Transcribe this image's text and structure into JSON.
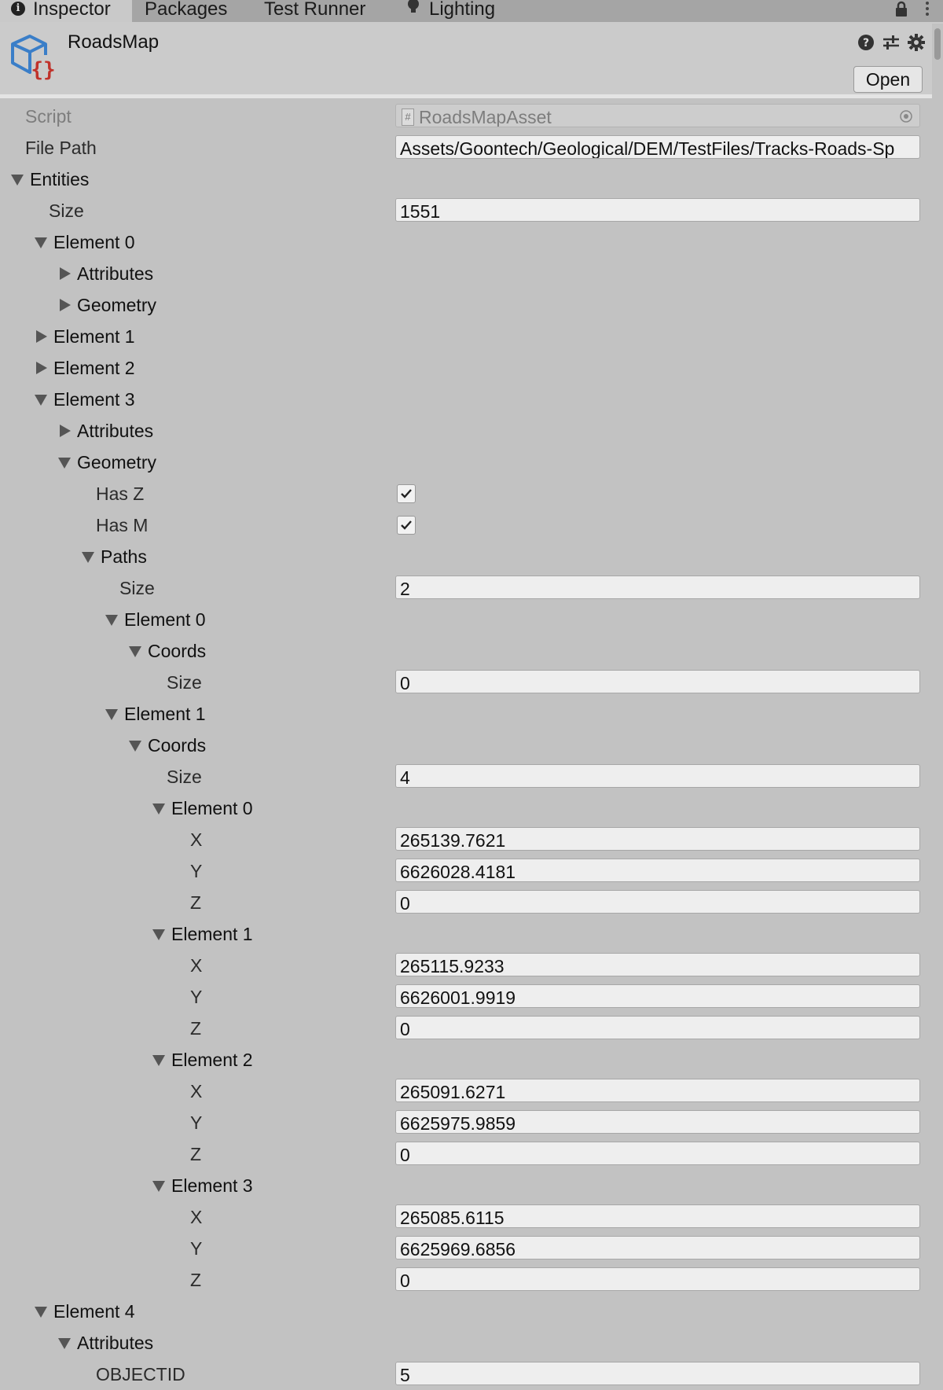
{
  "tabs": {
    "inspector": "Inspector",
    "packages": "Packages",
    "test_runner": "Test Runner",
    "lighting": "Lighting"
  },
  "header": {
    "title": "RoadsMap",
    "open_label": "Open"
  },
  "props": {
    "script_label": "Script",
    "script_value": "RoadsMapAsset",
    "file_path_label": "File Path",
    "file_path_value": "Assets/Goontech/Geological/DEM/TestFiles/Tracks-Roads-Sp",
    "entities_label": "Entities",
    "entities_size_label": "Size",
    "entities_size_value": "1551",
    "element0": "Element 0",
    "attributes": "Attributes",
    "geometry": "Geometry",
    "element1": "Element 1",
    "element2": "Element 2",
    "element3": "Element 3",
    "has_z_label": "Has Z",
    "has_z": true,
    "has_m_label": "Has M",
    "has_m": true,
    "paths_label": "Paths",
    "paths_size_label": "Size",
    "paths_size_value": "2",
    "path0_label": "Element 0",
    "coords_label": "Coords",
    "path0_coords_size_label": "Size",
    "path0_coords_size_value": "0",
    "path1_label": "Element 1",
    "path1_coords_size_label": "Size",
    "path1_coords_size_value": "4",
    "x_label": "X",
    "y_label": "Y",
    "z_label": "Z",
    "coords": [
      {
        "label": "Element 0",
        "x": "265139.7621",
        "y": "6626028.4181",
        "z": "0"
      },
      {
        "label": "Element 1",
        "x": "265115.9233",
        "y": "6626001.9919",
        "z": "0"
      },
      {
        "label": "Element 2",
        "x": "265091.6271",
        "y": "6625975.9859",
        "z": "0"
      },
      {
        "label": "Element 3",
        "x": "265085.6115",
        "y": "6625969.6856",
        "z": "0"
      }
    ],
    "element4": "Element 4",
    "objectid_label": "OBJECTID",
    "objectid_value": "5"
  }
}
